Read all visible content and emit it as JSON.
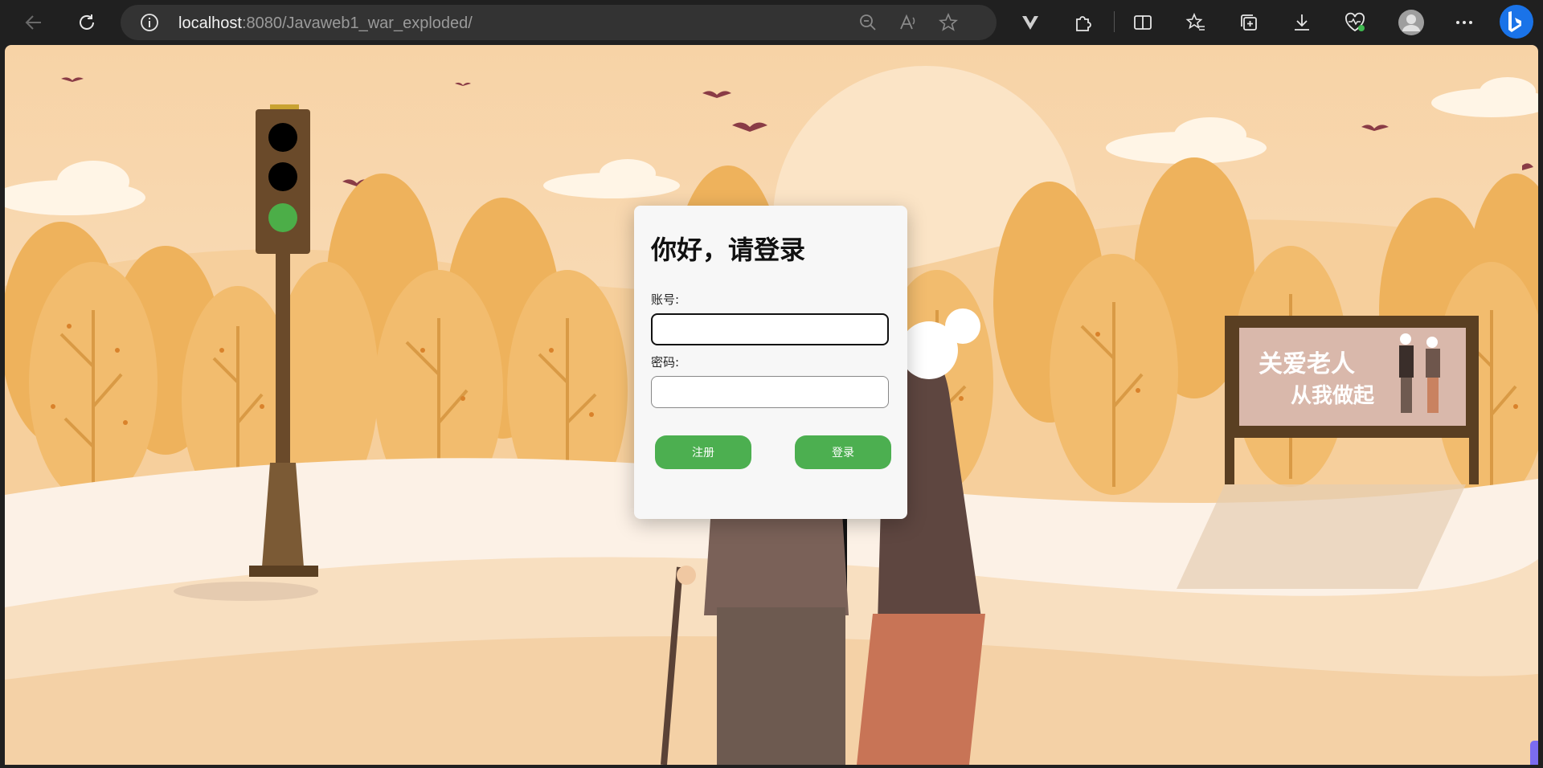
{
  "browser": {
    "url_host": "localhost",
    "url_path": ":8080/Javaweb1_war_exploded/",
    "icons": [
      "back-icon",
      "refresh-icon",
      "info-icon",
      "zoom-out-icon",
      "read-aloud-icon",
      "favorite-star-icon",
      "extension-v-icon",
      "extensions-puzzle-icon",
      "split-screen-icon",
      "favorites-icon",
      "collections-icon",
      "download-icon",
      "browser-essentials-icon",
      "profile-avatar-icon",
      "more-icon",
      "bing-copilot-icon"
    ]
  },
  "login": {
    "title": "你好，请登录",
    "account_label": "账号:",
    "account_value": "",
    "password_label": "密码:",
    "password_value": "",
    "register_button": "注册",
    "login_button": "登录"
  },
  "scene": {
    "billboard_line1": "关爱老人",
    "billboard_line2": "从我做起"
  },
  "colors": {
    "button_green": "#4caf50",
    "sky": "#f9dcb4",
    "tree_orange": "#f0b45e",
    "ground": "#fbeee0"
  }
}
